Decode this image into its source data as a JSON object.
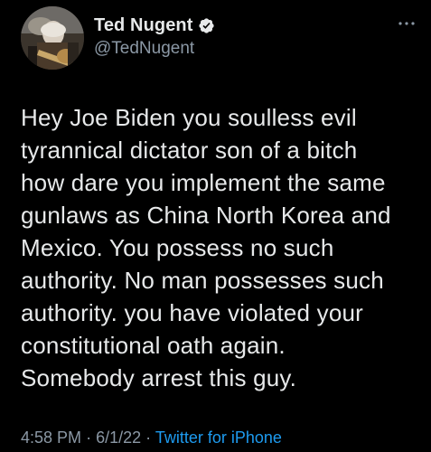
{
  "user": {
    "display_name": "Ted Nugent",
    "handle": "@TedNugent",
    "verified": true
  },
  "icons": {
    "avatar": "avatar-photo",
    "verified": "verified-badge-icon",
    "more": "more-options-icon"
  },
  "colors": {
    "background": "#000000",
    "text": "#e7e9ea",
    "secondary": "#8b98a5",
    "link": "#1d9bf0"
  },
  "tweet": {
    "text": "Hey Joe Biden you soulless evil\ntyrannical dictator son of a bitch\nhow dare you implement the same\ngunlaws as China North Korea and\nMexico. You possess no such\nauthority. No man possesses such\nauthority. you have violated your\nconstitutional oath again.\nSomebody arrest this guy."
  },
  "meta": {
    "time": "4:58 PM",
    "separator": "·",
    "date": "6/1/22",
    "source": "Twitter for iPhone"
  }
}
